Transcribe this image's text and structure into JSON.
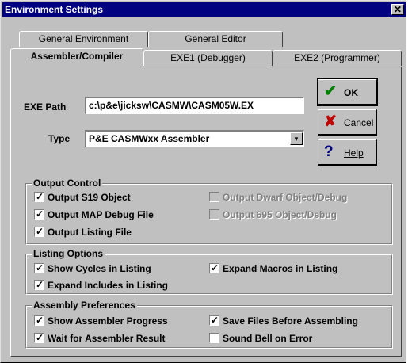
{
  "window": {
    "title": "Environment Settings",
    "close_label": "✕"
  },
  "tabs": {
    "back": [
      "General Environment",
      "General Editor"
    ],
    "front": [
      "Assembler/Compiler",
      "EXE1 (Debugger)",
      "EXE2 (Programmer)"
    ],
    "active": "Assembler/Compiler"
  },
  "fields": {
    "exe_path_label": "EXE Path",
    "exe_path_value": "c:\\p&e\\jicksw\\CASMW\\CASM05W.EX",
    "type_label": "Type",
    "type_value": "P&E CASMWxx Assembler"
  },
  "buttons": {
    "ok_label": "OK",
    "cancel_label": "Cancel",
    "help_label": "Help"
  },
  "icons": {
    "ok": "check-icon",
    "cancel": "x-icon",
    "help": "question-icon"
  },
  "colors": {
    "title_bar": "#000080",
    "ok_icon": "#008000",
    "cancel_icon": "#c00000",
    "help_icon": "#000080"
  },
  "output_control": {
    "title": "Output Control",
    "items": [
      {
        "label": "Output S19 Object",
        "checked": true,
        "enabled": true
      },
      {
        "label": "Output MAP Debug File",
        "checked": true,
        "enabled": true
      },
      {
        "label": "Output Listing File",
        "checked": true,
        "enabled": true
      },
      {
        "label": "Output Dwarf Object/Debug",
        "checked": false,
        "enabled": false
      },
      {
        "label": "Output 695 Object/Debug",
        "checked": false,
        "enabled": false
      }
    ]
  },
  "listing_options": {
    "title": "Listing Options",
    "items": [
      {
        "label": "Show Cycles in Listing",
        "checked": true
      },
      {
        "label": "Expand Includes in Listing",
        "checked": true
      },
      {
        "label": "Expand Macros in Listing",
        "checked": true
      }
    ]
  },
  "assembly_preferences": {
    "title": "Assembly Preferences",
    "items": [
      {
        "label": "Show Assembler Progress",
        "checked": true
      },
      {
        "label": "Wait for Assembler Result",
        "checked": true
      },
      {
        "label": "Save Files Before Assembling",
        "checked": true
      },
      {
        "label": "Sound Bell on Error",
        "checked": false
      }
    ]
  }
}
